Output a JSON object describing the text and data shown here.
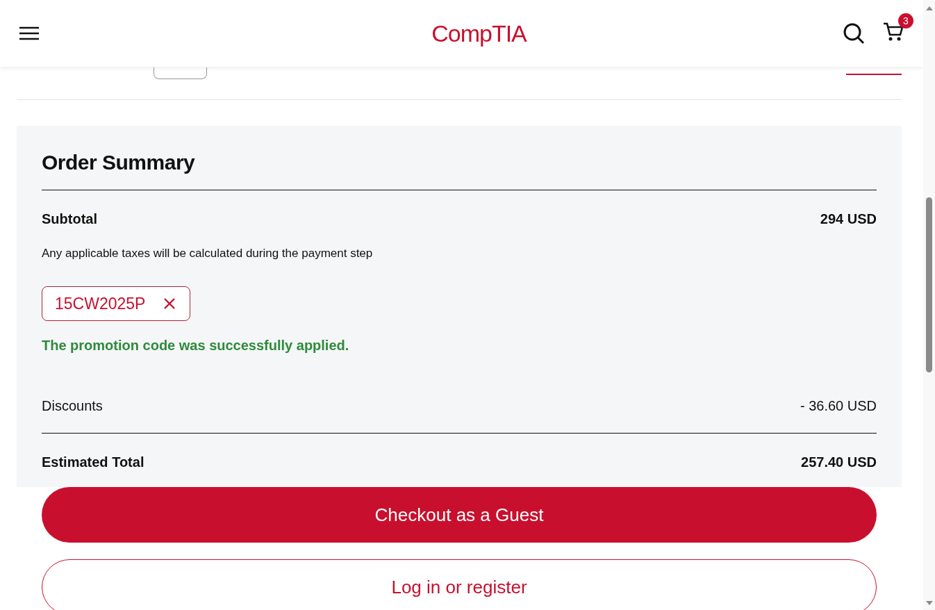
{
  "header": {
    "logo": "CompTIA",
    "cart_count": "3"
  },
  "order_summary": {
    "title": "Order Summary",
    "subtotal": {
      "label": "Subtotal",
      "value": "294 USD"
    },
    "tax_note": "Any applicable taxes will be calculated during the payment step",
    "promo_code": "15CW2025P",
    "promo_message": "The promotion code was successfully applied.",
    "discounts": {
      "label": "Discounts",
      "value": "- 36.60 USD"
    },
    "estimated_total": {
      "label": "Estimated Total",
      "value": "257.40 USD"
    }
  },
  "buttons": [
    {
      "kind": "primary",
      "label": "Checkout as a Guest"
    },
    {
      "kind": "secondary",
      "label": "Log in or register"
    }
  ]
}
